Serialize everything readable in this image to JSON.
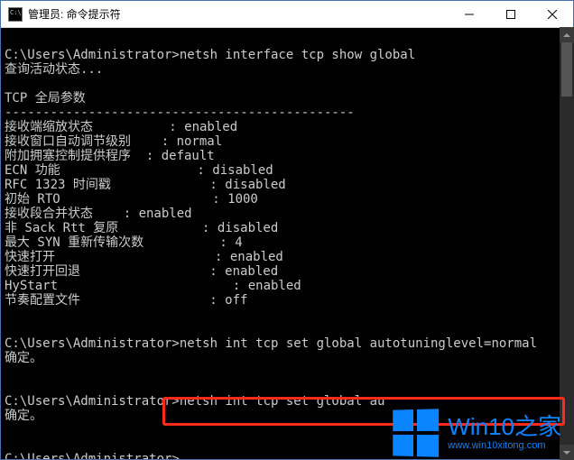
{
  "titlebar": {
    "title": "管理员: 命令提示符"
  },
  "terminal": {
    "lines": [
      "",
      "C:\\Users\\Administrator>netsh interface tcp show global",
      "查询活动状态...",
      "",
      "TCP 全局参数",
      "----------------------------------------------",
      "接收端缩放状态          : enabled",
      "接收窗口自动调节级别    : normal",
      "附加拥塞控制提供程序  : default",
      "ECN 功能                  : disabled",
      "RFC 1323 时间戳             : disabled",
      "初始 RTO                    : 1000",
      "接收段合并状态    : enabled",
      "非 Sack Rtt 复原           : disabled",
      "最大 SYN 重新传输次数          : 4",
      "快速打开                     : enabled",
      "快速打开回退                 : enabled",
      "HyStart                       : enabled",
      "节奏配置文件                 : off",
      "",
      "",
      "C:\\Users\\Administrator>netsh int tcp set global autotuninglevel=normal",
      "确定。",
      "",
      "",
      "C:\\Users\\Administrator>netsh int tcp set global au",
      "确定。",
      "",
      "",
      "C:\\Users\\Administrator>"
    ]
  },
  "watermark": {
    "brand": "Win10之家",
    "url": "www.win10xitong.com"
  }
}
